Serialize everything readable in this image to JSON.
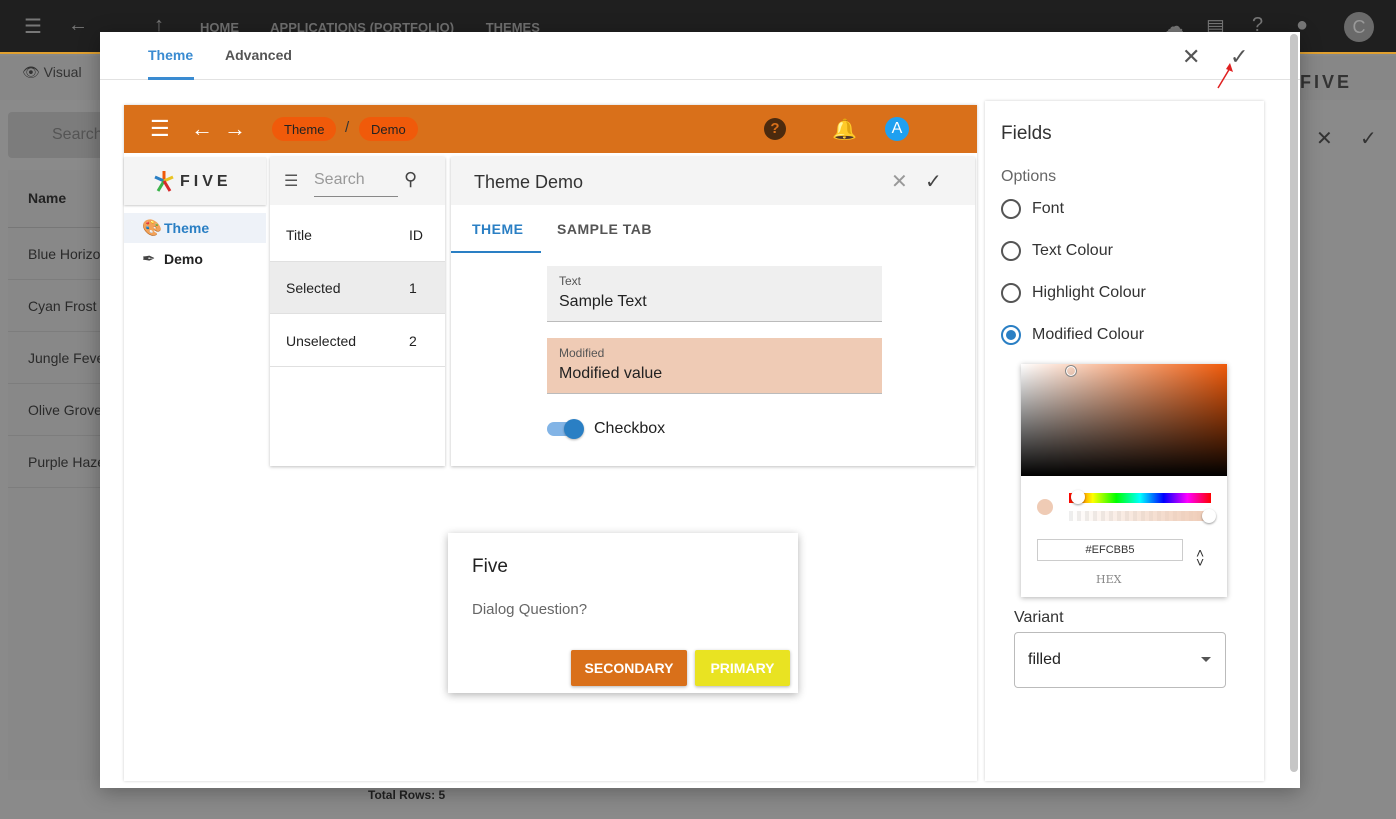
{
  "background": {
    "breadcrumbs": [
      "HOME",
      "APPLICATIONS (PORTFOLIO)",
      "THEMES"
    ],
    "avatar_letter": "C",
    "visual_label": "Visual",
    "search_placeholder": "Search",
    "list_header": "Name",
    "list_rows": [
      "Blue Horizon",
      "Cyan Frost",
      "Jungle Fever",
      "Olive Grove",
      "Purple Haze"
    ],
    "total_rows": "Total Rows: 5",
    "logo_text": "FIVE"
  },
  "modal": {
    "tabs": [
      "Theme",
      "Advanced"
    ],
    "active_tab": "Theme",
    "preview": {
      "breadcrumbs": [
        "Theme",
        "Demo"
      ],
      "separator": "/",
      "avatar_letter": "A",
      "logo_text": "FIVE",
      "nav": [
        {
          "label": "Theme",
          "icon": "palette-icon",
          "selected": true
        },
        {
          "label": "Demo",
          "icon": "eyedropper-icon",
          "selected": false
        }
      ],
      "list": {
        "search_placeholder": "Search",
        "columns": [
          "Title",
          "ID"
        ],
        "rows": [
          {
            "title": "Selected",
            "id": "1"
          },
          {
            "title": "Unselected",
            "id": "2"
          }
        ]
      },
      "form": {
        "title": "Theme Demo",
        "tabs": [
          "THEME",
          "SAMPLE TAB"
        ],
        "fields": [
          {
            "label": "Text",
            "value": "Sample Text"
          },
          {
            "label": "Modified",
            "value": "Modified value"
          }
        ],
        "checkbox_label": "Checkbox"
      },
      "dialog": {
        "title": "Five",
        "question": "Dialog Question?",
        "secondary_label": "SECONDARY",
        "primary_label": "PRIMARY"
      },
      "colors": {
        "bar": "#d9701a",
        "pill": "#f05a0a",
        "modified_bg": "#efcbb5",
        "primary_btn": "#e9e322"
      }
    },
    "fields_panel": {
      "title": "Fields",
      "options_label": "Options",
      "options": [
        "Font",
        "Text Colour",
        "Highlight Colour",
        "Modified Colour"
      ],
      "selected_option": "Modified Colour",
      "color_picker": {
        "hex_value": "#EFCBB5",
        "mode_label": "HEX"
      },
      "variant": {
        "label": "Variant",
        "value": "filled"
      }
    }
  }
}
